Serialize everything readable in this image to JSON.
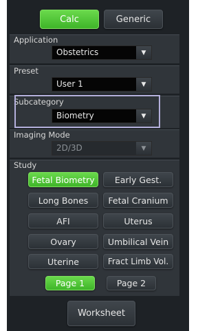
{
  "top_buttons": {
    "calc": "Calc",
    "generic": "Generic"
  },
  "application": {
    "label": "Application",
    "value": "Obstetrics"
  },
  "preset": {
    "label": "Preset",
    "value": "User 1"
  },
  "subcategory": {
    "label": "Subcategory",
    "value": "Biometry"
  },
  "imaging_mode": {
    "label": "Imaging Mode",
    "value": "2D/3D"
  },
  "study": {
    "label": "Study",
    "items": [
      "Fetal Biometry",
      "Early Gest.",
      "Long Bones",
      "Fetal Cranium",
      "AFI",
      "Uterus",
      "Ovary",
      "Umbilical Vein",
      "Uterine",
      "Fract Limb Vol."
    ],
    "selected": "Fetal Biometry"
  },
  "pages": {
    "page1": "Page 1",
    "page2": "Page 2"
  },
  "worksheet": "Worksheet",
  "colors": {
    "accent_green": "#4cc234",
    "highlight_border": "#b4b0dc",
    "panel_bg": "#1e2226"
  },
  "icons": {
    "dropdown_arrow": "caret-down-icon"
  }
}
